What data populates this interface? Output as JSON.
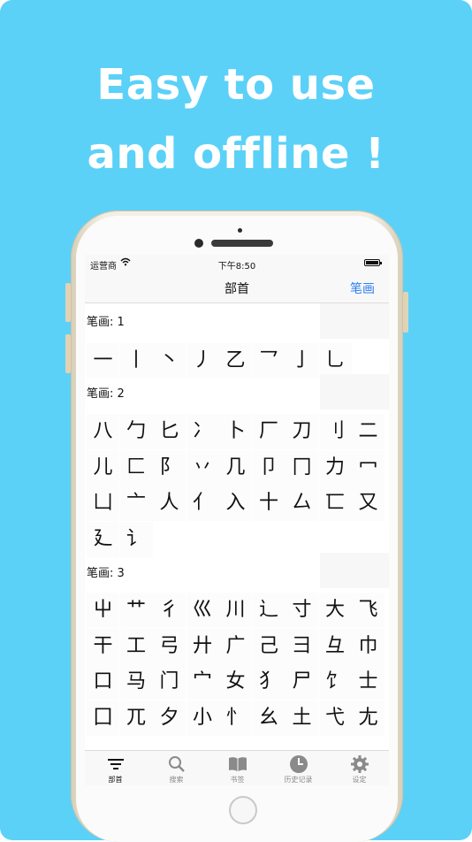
{
  "headline": {
    "line1": "Easy to use",
    "line2": "and offline !"
  },
  "statusbar": {
    "carrier": "运营商",
    "time": "下午8:50"
  },
  "navbar": {
    "title": "部首",
    "right_button": "笔画"
  },
  "sections": [
    {
      "label": "笔画: 1",
      "chars": [
        "一",
        "丨",
        "丶",
        "丿",
        "乙",
        "乛",
        "亅",
        "乚"
      ]
    },
    {
      "label": "笔画: 2",
      "chars": [
        "八",
        "勹",
        "匕",
        "冫",
        "卜",
        "厂",
        "刀",
        "刂",
        "二",
        "儿",
        "匚",
        "阝",
        "丷",
        "几",
        "卩",
        "冂",
        "力",
        "冖",
        "凵",
        "亠",
        "人",
        "亻",
        "入",
        "十",
        "厶",
        "匸",
        "又",
        "廴",
        "讠"
      ]
    },
    {
      "label": "笔画: 3",
      "chars": [
        "屮",
        "艹",
        "彳",
        "巛",
        "川",
        "辶",
        "寸",
        "大",
        "飞",
        "干",
        "工",
        "弓",
        "廾",
        "广",
        "己",
        "彐",
        "彑",
        "巾",
        "口",
        "马",
        "门",
        "宀",
        "女",
        "犭",
        "尸",
        "饣",
        "士",
        "囗",
        "兀",
        "夕",
        "小",
        "忄",
        "幺",
        "土",
        "弋",
        "尢"
      ]
    }
  ],
  "tabbar": {
    "items": [
      {
        "label": "部首",
        "icon": "filter-lines-icon",
        "active": true
      },
      {
        "label": "搜索",
        "icon": "search-icon",
        "active": false
      },
      {
        "label": "书签",
        "icon": "book-icon",
        "active": false
      },
      {
        "label": "历史记录",
        "icon": "clock-icon",
        "active": false
      },
      {
        "label": "设定",
        "icon": "gear-icon",
        "active": false
      }
    ]
  },
  "colors": {
    "background": "#5bd1f8",
    "accent": "#2f7ff3"
  }
}
